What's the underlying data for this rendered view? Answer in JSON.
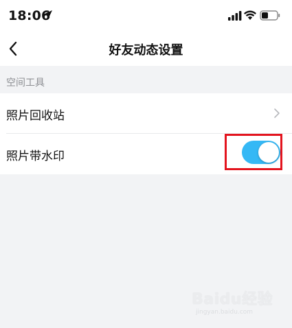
{
  "status_bar": {
    "time": "18:06",
    "icons": [
      "location-arrow-icon",
      "signal-icon",
      "wifi-icon",
      "battery-icon"
    ]
  },
  "nav": {
    "title": "好友动态设置",
    "back_icon": "chevron-left-icon"
  },
  "section": {
    "header": "空间工具"
  },
  "rows": [
    {
      "label": "照片回收站",
      "accessory": "chevron-right-icon"
    },
    {
      "label": "照片带水印",
      "accessory": "toggle",
      "toggle_on": true
    }
  ],
  "colors": {
    "toggle_on": "#35b8f5",
    "highlight": "#e3141e",
    "background": "#f2f3f5"
  },
  "watermark": {
    "logo": "Baidu经验",
    "url": "jingyan.baidu.com"
  }
}
